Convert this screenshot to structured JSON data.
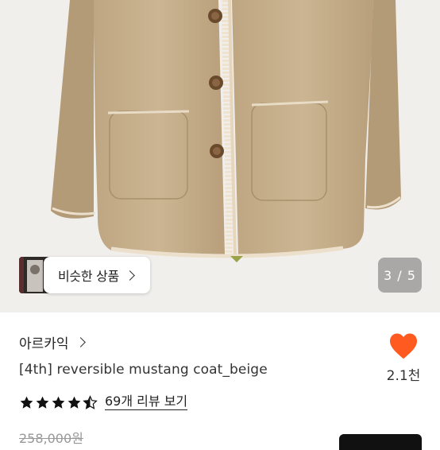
{
  "gallery": {
    "similar_label": "비슷한 상품",
    "counter": "3 / 5"
  },
  "product": {
    "brand": "아르카익",
    "title": "[4th] reversible mustang coat_beige",
    "rating": 4.5,
    "review_link": "69개 리뷰 보기",
    "original_price": "258,000원",
    "like_count": "2.1천"
  },
  "colors": {
    "heart": "#ff5a1f",
    "coat": "#c7b08e"
  },
  "icons": {
    "like": "heart-icon",
    "similar_chevron": "chevron-right-icon",
    "brand_chevron": "chevron-right-icon"
  }
}
